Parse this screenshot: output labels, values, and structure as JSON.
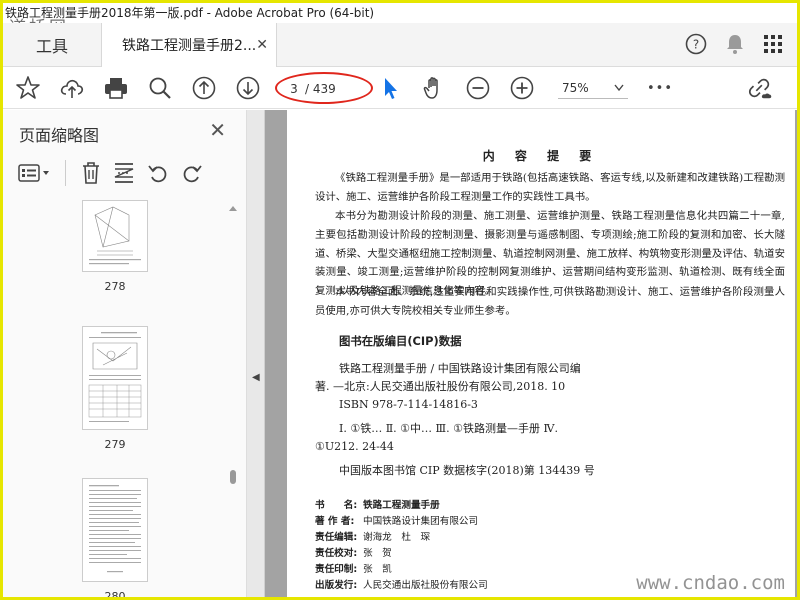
{
  "window": {
    "title": "铁路工程测量手册2018年第一版.pdf - Adobe Acrobat Pro (64-bit)",
    "watermark_logo": "道桥网"
  },
  "tabs": {
    "tools_label": "工具",
    "doc_label": "铁路工程测量手册2..."
  },
  "toolbar": {
    "page_current": "3",
    "page_total": "/ 439",
    "zoom": "75%",
    "more": "•••"
  },
  "sidebar": {
    "title": "页面缩略图",
    "thumbnails": [
      {
        "label": "278"
      },
      {
        "label": "279"
      },
      {
        "label": "280"
      }
    ]
  },
  "document": {
    "heading": "内 容 提 要",
    "paragraphs": [
      "《铁路工程测量手册》是一部适用于铁路(包括高速铁路、客运专线,以及新建和改建铁路)工程勘测设计、施工、运营维护各阶段工程测量工作的实践性工具书。",
      "本书分为勘测设计阶段的测量、施工测量、运营维护测量、铁路工程测量信息化共四篇二十一章,主要包括勘测设计阶段的控制测量、摄影测量与遥感制图、专项测绘;施工阶段的复测和加密、长大隧道、桥梁、大型交通枢纽施工控制测量、轨道控制网测量、施工放样、构筑物变形测量及评估、轨道安装测量、竣工测量;运营维护阶段的控制网复测维护、运营期间结构变形监测、轨道检测、既有线全面复测;以及铁路工程测量信息化等内容。",
      "本书内容全面、系统,注重实用性和实践操作性,可供铁路勘测设计、施工、运营维护各阶段测量人员使用,亦可供大专院校相关专业师生参考。"
    ],
    "cip_title": "图书在版编目(CIP)数据",
    "cip_lines": [
      "铁路工程测量手册 / 中国铁路设计集团有限公司编",
      "著. —北京:人民交通出版社股份有限公司,2018. 10",
      "ISBN 978-7-114-14816-3",
      "Ⅰ. ①铁…   Ⅱ. ①中…   Ⅲ. ①铁路测量—手册   Ⅳ.",
      "①U212. 24-44",
      "中国版本图书馆 CIP 数据核字(2018)第 134439 号"
    ],
    "meta": [
      {
        "key": "书　　名:",
        "value": "铁路工程测量手册"
      },
      {
        "key": "著 作 者:",
        "value": "中国铁路设计集团有限公司"
      },
      {
        "key": "责任编辑:",
        "value": "谢海龙　杜　琛"
      },
      {
        "key": "责任校对:",
        "value": "张　贺"
      },
      {
        "key": "责任印制:",
        "value": "张　凯"
      },
      {
        "key": "出版发行:",
        "value": "人民交通出版社股份有限公司"
      }
    ]
  },
  "watermark_site": "www.cndao.com"
}
